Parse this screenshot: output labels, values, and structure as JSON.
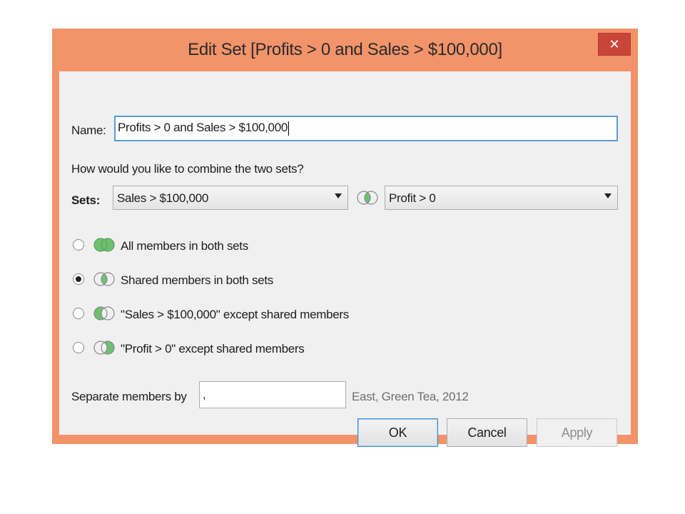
{
  "window": {
    "title": "Edit Set [Profits > 0 and Sales > $100,000]",
    "close_glyph": "✕",
    "accent_color": "#f2936a"
  },
  "name_field": {
    "label": "Name:",
    "value": "Profits > 0 and Sales > $100,000"
  },
  "combine": {
    "question": "How would you like to combine the two sets?",
    "sets_label": "Sets:",
    "left_set": "Sales > $100,000",
    "right_set": "Profit > 0",
    "operator_icon": "venn-intersection-icon"
  },
  "options": [
    {
      "label": "All members in both sets",
      "icon": "venn-union-icon",
      "checked": false
    },
    {
      "label": "Shared members in both sets",
      "icon": "venn-intersection-icon",
      "checked": true
    },
    {
      "label": "\"Sales > $100,000\" except shared members",
      "icon": "venn-left-only-icon",
      "checked": false
    },
    {
      "label": "\"Profit > 0\" except shared members",
      "icon": "venn-right-only-icon",
      "checked": false
    }
  ],
  "separator": {
    "label": "Separate members by",
    "value": ",",
    "example": "East, Green Tea, 2012"
  },
  "buttons": {
    "ok": "OK",
    "cancel": "Cancel",
    "apply": "Apply"
  },
  "colors": {
    "venn_green": "#6cc070",
    "focus_blue": "#5a9bd8"
  }
}
